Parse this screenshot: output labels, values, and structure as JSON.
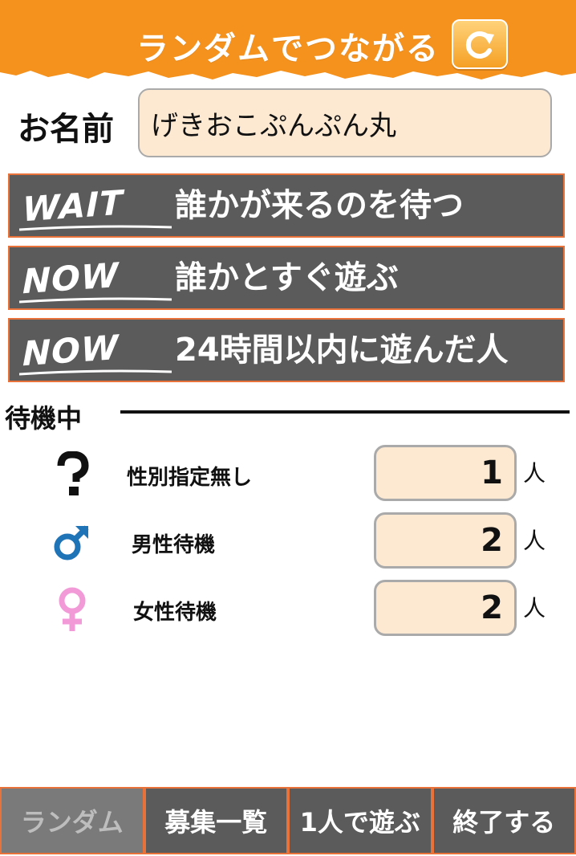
{
  "header": {
    "title": "ランダムでつながる",
    "refresh_icon": "refresh-icon",
    "color": "#f5921e"
  },
  "name": {
    "label": "お名前",
    "value": "げきおこぷんぷん丸"
  },
  "actions": [
    {
      "tag": "WAIT",
      "label": "誰かが来るのを待つ"
    },
    {
      "tag": "NOW",
      "label": "誰かとすぐ遊ぶ"
    },
    {
      "tag": "NOW",
      "label": "24時間以内に遊んだ人"
    }
  ],
  "waiting": {
    "title": "待機中",
    "rows": [
      {
        "icon": "question-icon",
        "label": "性別指定無し",
        "value": "1",
        "unit": "人"
      },
      {
        "icon": "male-icon",
        "label": "男性待機",
        "value": "2",
        "unit": "人"
      },
      {
        "icon": "female-icon",
        "label": "女性待機",
        "value": "2",
        "unit": "人"
      }
    ]
  },
  "bottom_nav": {
    "items": [
      {
        "label": "ランダム",
        "active": true
      },
      {
        "label": "募集一覧",
        "active": false
      },
      {
        "label": "1人で遊ぶ",
        "active": false
      },
      {
        "label": "終了する",
        "active": false
      }
    ]
  },
  "colors": {
    "accent": "#f5921e",
    "button_bg": "#5b5b5b",
    "button_border": "#e8723a",
    "field_bg": "#fde9d2",
    "male": "#1f73b7",
    "female": "#f29ad8"
  }
}
